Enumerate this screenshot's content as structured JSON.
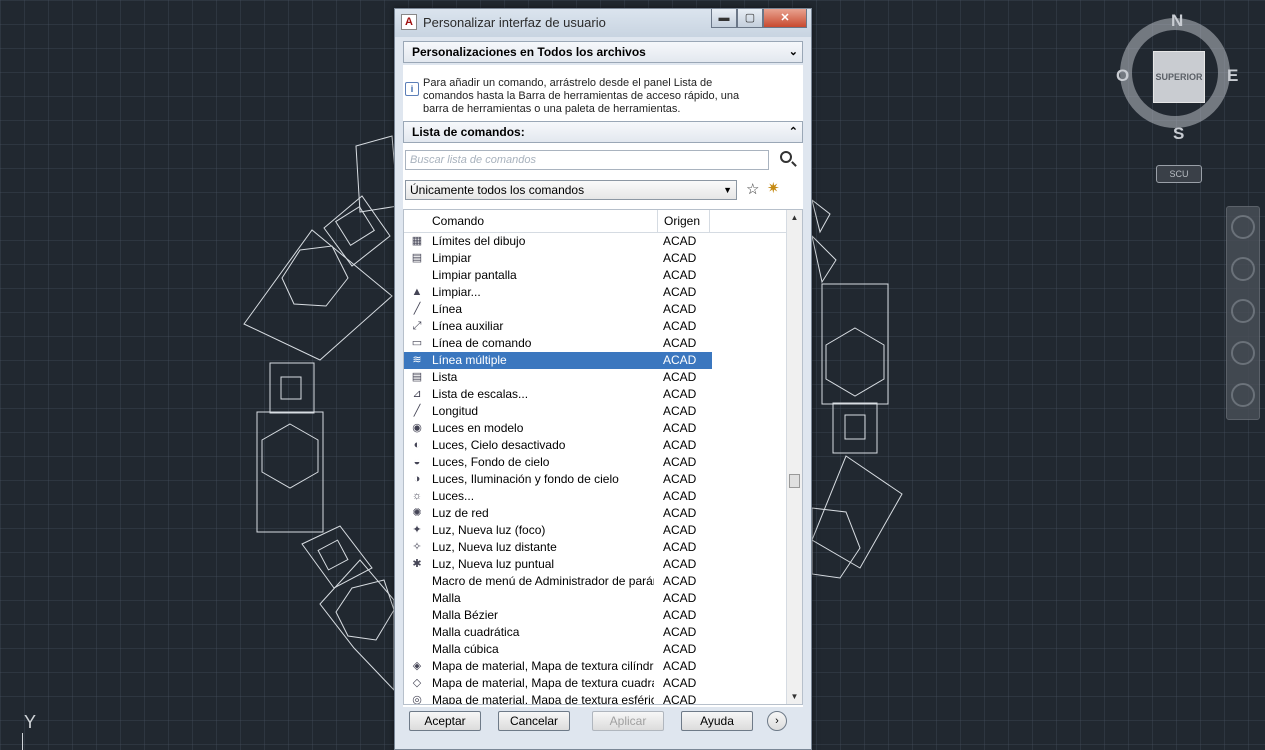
{
  "dialog": {
    "title": "Personalizar interfaz de usuario",
    "app_icon": "A",
    "controls": {
      "minimize": "▬",
      "maximize": "▢",
      "close": "✕"
    }
  },
  "customizations_header": {
    "label": "Personalizaciones en Todos los archivos",
    "chevron": "⌄"
  },
  "info": {
    "icon": "i",
    "text": "Para añadir un comando, arrástrelo desde el panel Lista de comandos hasta la Barra de herramientas de acceso rápido, una barra de herramientas o una paleta de herramientas."
  },
  "command_list_header": {
    "label": "Lista de comandos:",
    "chevron": "⌃"
  },
  "search": {
    "placeholder": "Buscar lista de comandos",
    "value": ""
  },
  "filter": {
    "selected": "Únicamente todos los comandos"
  },
  "columns": {
    "command": "Comando",
    "origin": "Origen"
  },
  "commands": [
    {
      "name": "Límites del dibujo",
      "origin": "ACAD",
      "icon": "limits-icon"
    },
    {
      "name": "Limpiar",
      "origin": "ACAD",
      "icon": "purge-icon"
    },
    {
      "name": "Limpiar pantalla",
      "origin": "ACAD",
      "icon": ""
    },
    {
      "name": "Limpiar...",
      "origin": "ACAD",
      "icon": "purge-dialog-icon"
    },
    {
      "name": "Línea",
      "origin": "ACAD",
      "icon": "line-icon"
    },
    {
      "name": "Línea auxiliar",
      "origin": "ACAD",
      "icon": "xline-icon"
    },
    {
      "name": "Línea de comando",
      "origin": "ACAD",
      "icon": "command-line-icon"
    },
    {
      "name": "Línea múltiple",
      "origin": "ACAD",
      "icon": "mline-icon",
      "selected": true
    },
    {
      "name": "Lista",
      "origin": "ACAD",
      "icon": "list-icon"
    },
    {
      "name": "Lista de escalas...",
      "origin": "ACAD",
      "icon": "scale-list-icon"
    },
    {
      "name": "Longitud",
      "origin": "ACAD",
      "icon": "lengthen-icon"
    },
    {
      "name": "Luces en modelo",
      "origin": "ACAD",
      "icon": "lights-model-icon"
    },
    {
      "name": "Luces, Cielo desactivado",
      "origin": "ACAD",
      "icon": "sky-off-icon"
    },
    {
      "name": "Luces, Fondo de cielo",
      "origin": "ACAD",
      "icon": "sky-background-icon"
    },
    {
      "name": "Luces, Iluminación y fondo de cielo",
      "origin": "ACAD",
      "icon": "sky-illumination-icon"
    },
    {
      "name": "Luces...",
      "origin": "ACAD",
      "icon": "sun-icon"
    },
    {
      "name": "Luz de red",
      "origin": "ACAD",
      "icon": "weblight-icon"
    },
    {
      "name": "Luz, Nueva luz (foco)",
      "origin": "ACAD",
      "icon": "spotlight-icon"
    },
    {
      "name": "Luz, Nueva luz distante",
      "origin": "ACAD",
      "icon": "distant-light-icon"
    },
    {
      "name": "Luz, Nueva luz puntual",
      "origin": "ACAD",
      "icon": "point-light-icon"
    },
    {
      "name": "Macro de menú de Administrador de paráme...",
      "origin": "ACAD",
      "icon": ""
    },
    {
      "name": "Malla",
      "origin": "ACAD",
      "icon": ""
    },
    {
      "name": "Malla Bézier",
      "origin": "ACAD",
      "icon": ""
    },
    {
      "name": "Malla cuadrática",
      "origin": "ACAD",
      "icon": ""
    },
    {
      "name": "Malla cúbica",
      "origin": "ACAD",
      "icon": ""
    },
    {
      "name": "Mapa de material, Mapa de textura cilíndrica",
      "origin": "ACAD",
      "icon": "material-cylindrical-icon"
    },
    {
      "name": "Mapa de material, Mapa de textura cuadrada",
      "origin": "ACAD",
      "icon": "material-box-icon"
    },
    {
      "name": "Mapa de material, Mapa de textura esférica",
      "origin": "ACAD",
      "icon": "material-spherical-icon"
    }
  ],
  "buttons": {
    "ok": "Aceptar",
    "cancel": "Cancelar",
    "apply": "Aplicar",
    "help": "Ayuda",
    "more": "›"
  },
  "viewcube": {
    "face": "SUPERIOR",
    "north": "N",
    "south": "S",
    "east": "E",
    "west": "O",
    "ucs": "SCU"
  },
  "ucs_axis": "Y"
}
